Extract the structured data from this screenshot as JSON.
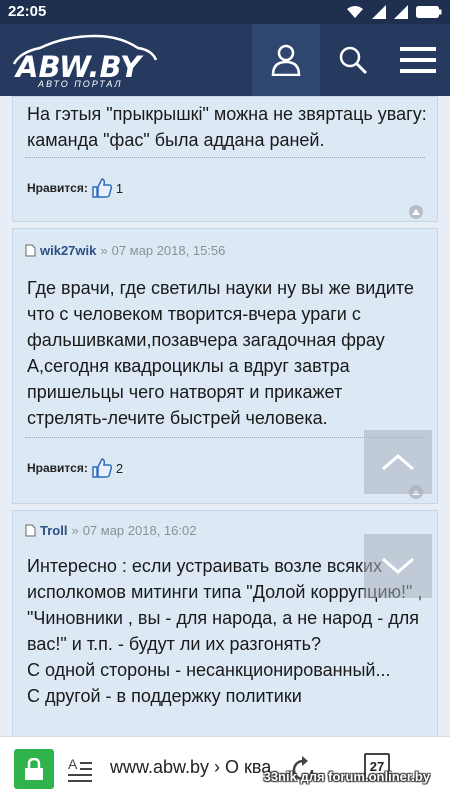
{
  "status_bar": {
    "time": "22:05"
  },
  "header": {
    "logo_text": "ABW.BY",
    "logo_subtitle": "АВТО ПОРТАЛ",
    "icons": [
      "user-icon",
      "search-icon",
      "menu-icon"
    ]
  },
  "posts": [
    {
      "text": "На гэтыя \"прыкрышкі\" можна не звяртаць увагу: каманда \"фас\" была аддана раней.",
      "likes_label": "Нравится:",
      "likes_count": "1"
    },
    {
      "author": "wik27wik",
      "separator": "»",
      "date": "07 мар 2018, 15:56",
      "text": "Где врачи, где светилы науки ну вы же видите что с человеком творится-вчера ураги с фальшивками,позавчера загадочная фрау А,сегодня квадроциклы а вдруг завтра пришельцы чего натворят и прикажет стрелять-лечите быстрей человека.",
      "likes_label": "Нравится:",
      "likes_count": "2"
    },
    {
      "author": "Troll",
      "separator": "»",
      "date": "07 мар 2018, 16:02",
      "text_lines": [
        "Интересно : если устраивать возле всяких исполкомов митинги типа \"Долой коррупцию!\" , \"Чиновники , вы - для народа, а не народ - для вас!\" и т.п. - будут ли их разгонять?",
        "С одной стороны - несанкционированный...",
        "С другой - в поддержку политики"
      ]
    }
  ],
  "browser": {
    "url": "www.abw.by › О ква",
    "tab_count": "27",
    "watermark": "33nik для forum.onliner.by"
  },
  "colors": {
    "header_bg": "#263a60",
    "post_bg": "#dce9f5",
    "author": "#2a4f85",
    "secure_green": "#2fb34a"
  }
}
